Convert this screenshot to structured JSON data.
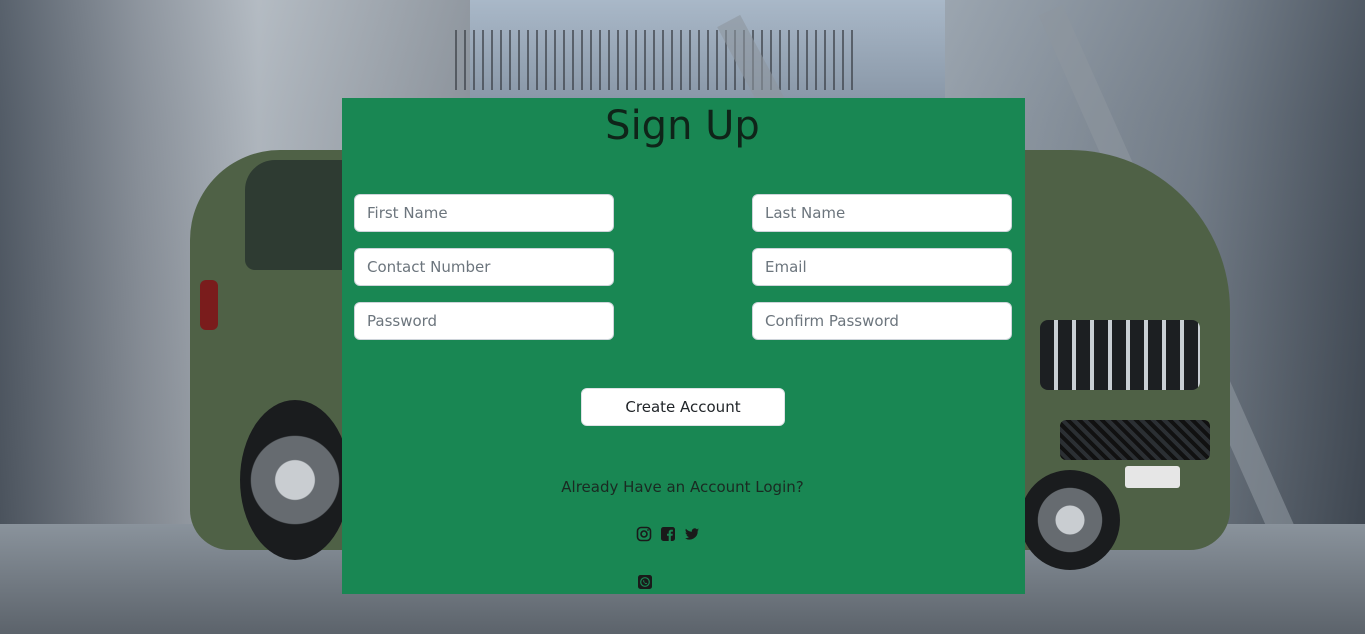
{
  "form": {
    "title": "Sign Up",
    "fields": {
      "first_name": {
        "placeholder": "First Name"
      },
      "last_name": {
        "placeholder": "Last Name"
      },
      "contact_number": {
        "placeholder": "Contact Number"
      },
      "email": {
        "placeholder": "Email"
      },
      "password": {
        "placeholder": "Password"
      },
      "confirm_password": {
        "placeholder": "Confirm Password"
      }
    },
    "submit_label": "Create Account",
    "login_link": "Already Have an Account Login?",
    "panel_color": "#198753"
  },
  "social": {
    "icons": [
      "instagram-icon",
      "facebook-icon",
      "twitter-icon",
      "whatsapp-icon"
    ]
  }
}
